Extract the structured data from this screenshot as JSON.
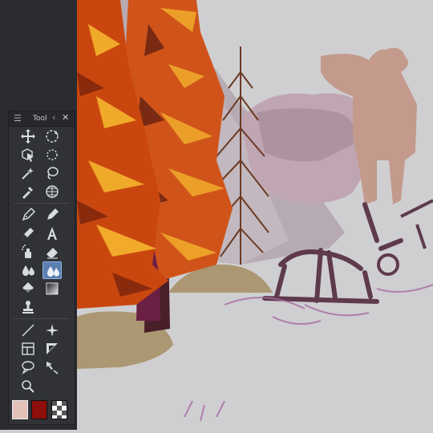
{
  "tool_panel": {
    "title": "Tool",
    "menu_icon": "hamburger-icon",
    "collapse_icon": "chevron-left-icon",
    "close_icon": "close-icon",
    "active_tool": "blend-tool",
    "tools": [
      "move-tool-icon",
      "rotate-canvas-icon",
      "object-select-icon",
      "selection-area-icon",
      "magic-wand-icon",
      "lasso-fill-icon",
      "eyedropper-icon",
      "grid-ruler-icon",
      "pen-icon",
      "marker-icon",
      "pencil-icon",
      "text-tool-icon",
      "airbrush-icon",
      "eraser-icon",
      "water-drops-icon",
      "blend-tool-icon",
      "fill-bucket-icon",
      "gradient-icon",
      "stamp-icon",
      "line-tool-icon",
      "sparkle-tool-icon",
      "frame-border-icon",
      "ruler-triangle-icon",
      "speech-balloon-icon",
      "correct-line-icon",
      "zoom-icon"
    ]
  },
  "colors": {
    "main_color": "#e4c1b7",
    "sub_color": "#8e0e0c",
    "panel_bg": "#303236",
    "canvas_bg": "#cfcfd1",
    "active_highlight": "#5b7fb1"
  },
  "color_swatches": {
    "main": "main-color-swatch",
    "sub": "sub-color-swatch",
    "transparent": "transparent-color-swatch"
  }
}
